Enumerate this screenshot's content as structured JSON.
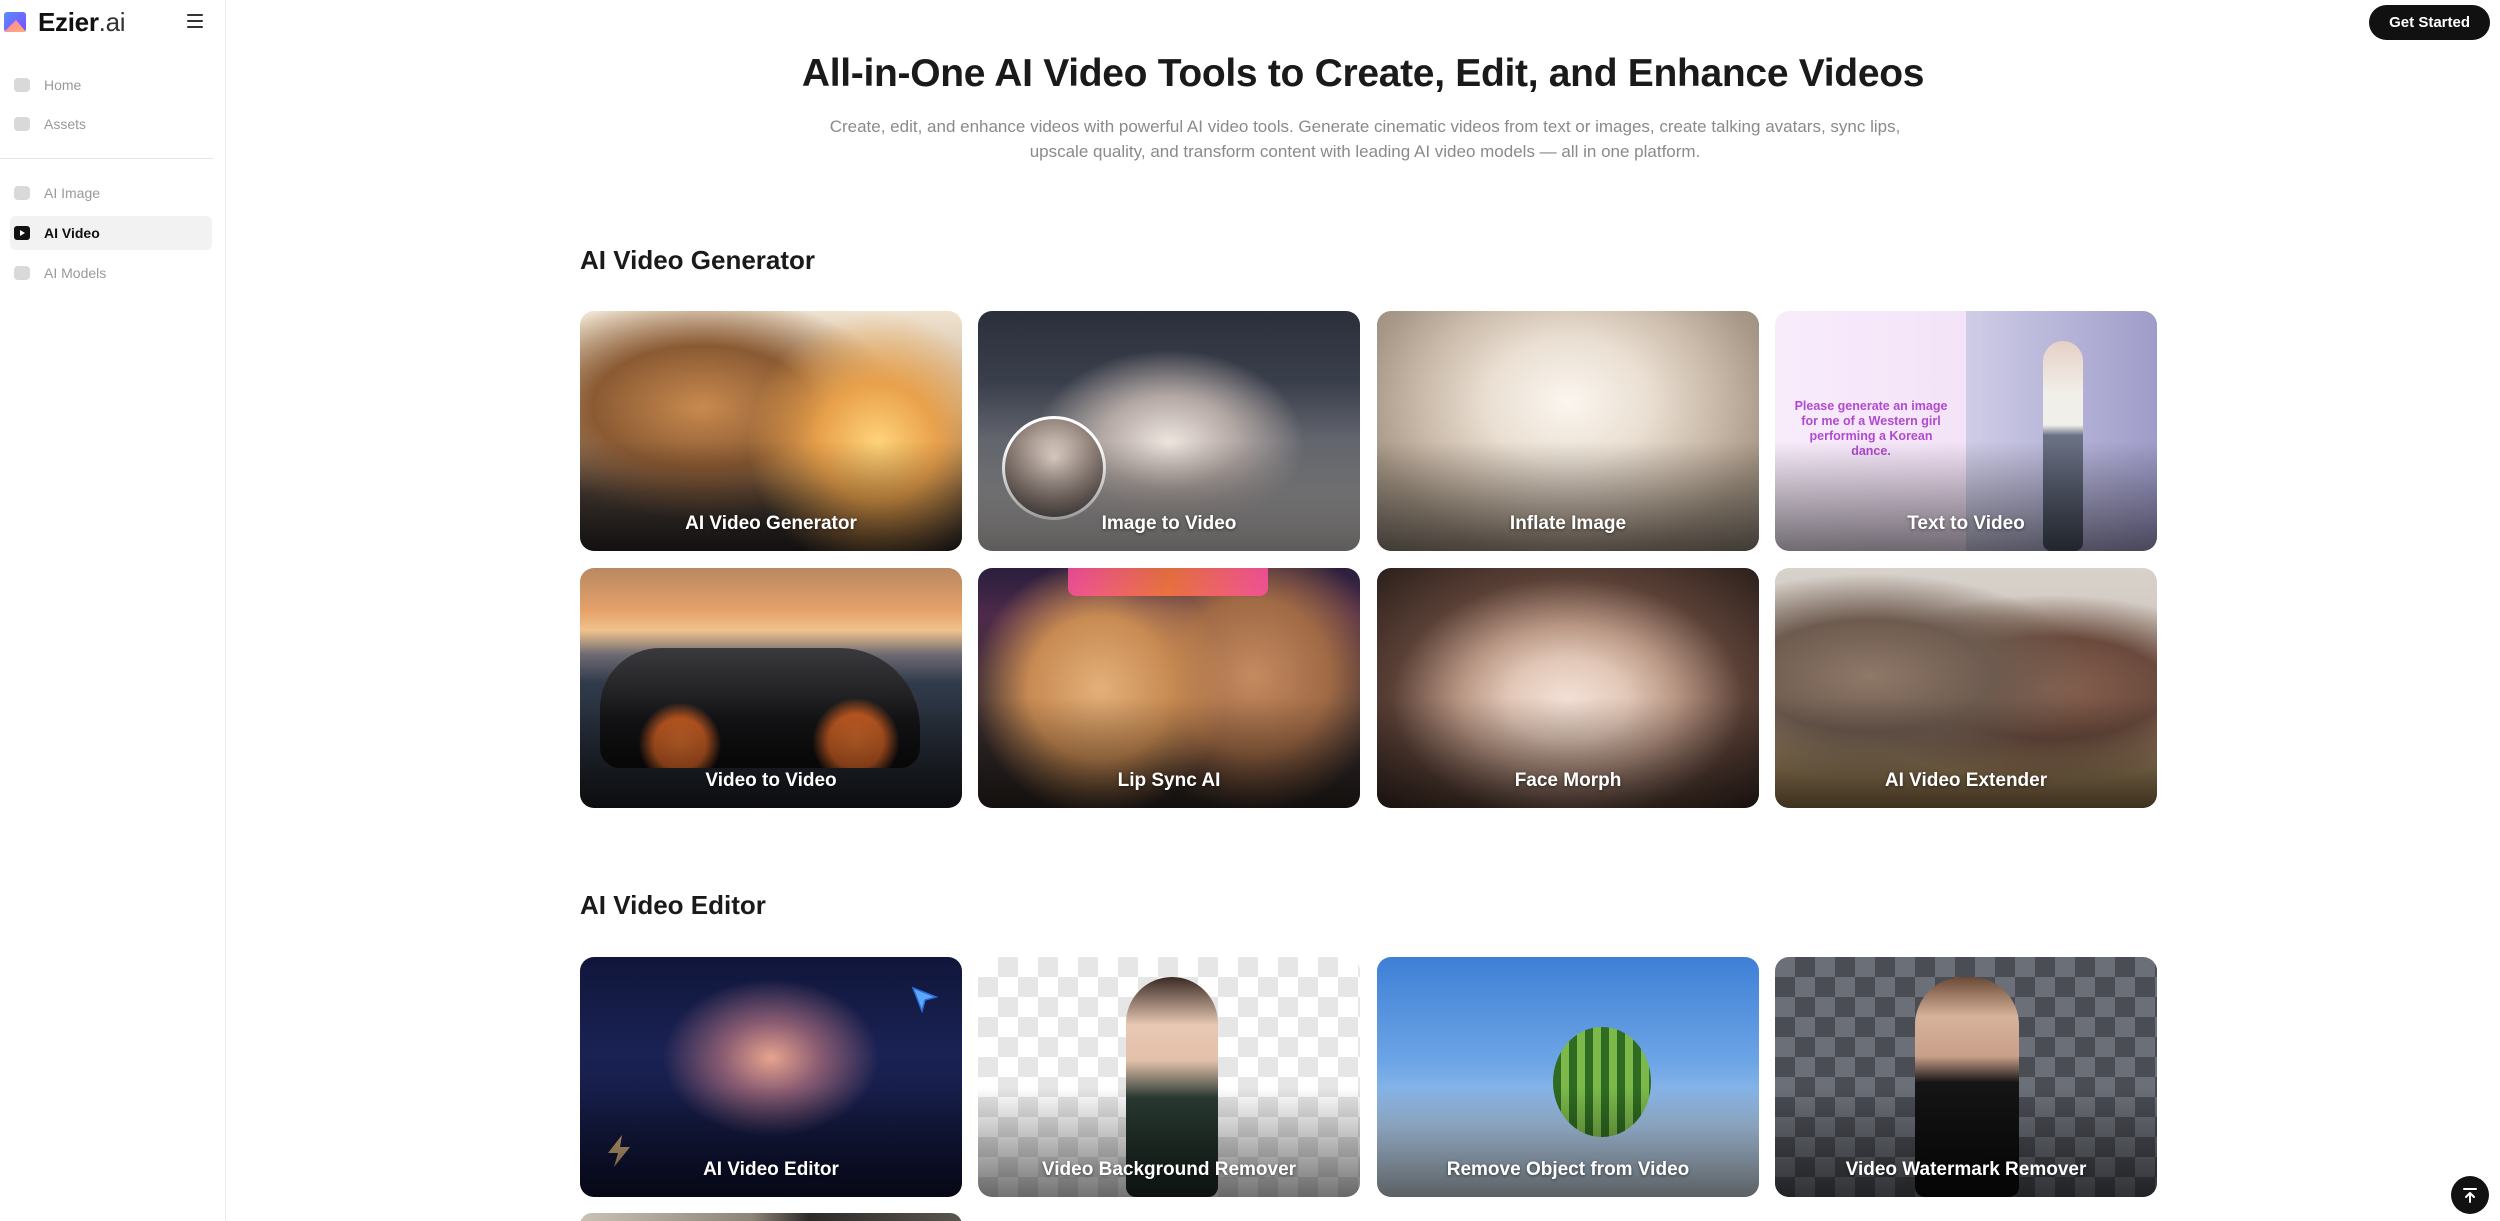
{
  "brand": {
    "name": "Ezier",
    "suffix": ".ai"
  },
  "sidebar": {
    "items": [
      {
        "label": "Home",
        "icon": "home-icon"
      },
      {
        "label": "Assets",
        "icon": "assets-icon"
      },
      {
        "label": "AI Image",
        "icon": "image-icon"
      },
      {
        "label": "AI Video",
        "icon": "video-icon",
        "active": true
      },
      {
        "label": "AI Models",
        "icon": "models-icon"
      }
    ]
  },
  "header": {
    "cta_label": "Get Started"
  },
  "hero": {
    "title": "All-in-One AI Video Tools to Create, Edit, and Enhance Videos",
    "subtitle": "Create, edit, and enhance videos with powerful AI video tools. Generate cinematic videos from text or images, create talking avatars, sync lips, upscale quality, and transform content with leading AI video models — all in one platform."
  },
  "sections": [
    {
      "title": "AI Video Generator",
      "cards": [
        {
          "label": "AI Video Generator"
        },
        {
          "label": "Image to Video"
        },
        {
          "label": "Inflate Image"
        },
        {
          "label": "Text to Video",
          "overlay_text": "Please generate an image for me of a Western girl performing a Korean dance."
        },
        {
          "label": "Video to Video"
        },
        {
          "label": "Lip Sync AI"
        },
        {
          "label": "Face Morph"
        },
        {
          "label": "AI Video Extender"
        }
      ]
    },
    {
      "title": "AI Video Editor",
      "cards": [
        {
          "label": "AI Video Editor"
        },
        {
          "label": "Video Background Remover"
        },
        {
          "label": "Remove Object from Video"
        },
        {
          "label": "Video Watermark Remover"
        }
      ]
    }
  ],
  "colors": {
    "accent": "#111111",
    "active_bg": "#f2f2f2",
    "muted_text": "#8a8a8a"
  }
}
